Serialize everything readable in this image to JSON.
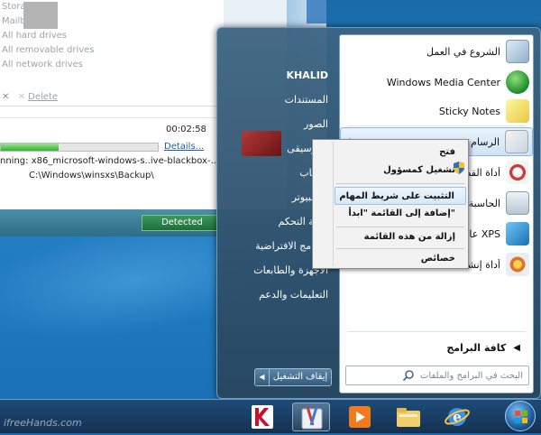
{
  "background_app": {
    "drives": [
      "All hard drives",
      "All removable drives",
      "All network drives"
    ],
    "drive_items": [
      "Storage",
      "Mailboxes",
      "All hard drives",
      "All removable drives",
      "All network drives"
    ],
    "delete_label": "Delete",
    "elapsed_time": "00:02:58",
    "progress_fraction": 0.37,
    "details_link": "Details...",
    "scanning_line": "nning:  x86_microsoft-windows-s..ive-blackbox-...",
    "scanning_path": "C:\\Windows\\winsxs\\Backup\\",
    "detected_button": "Detected"
  },
  "start_menu": {
    "programs": [
      {
        "label": "الشروع في العمل",
        "icon": "getting-started-icon",
        "arrow": false
      },
      {
        "label": "Windows Media Center",
        "icon": "media-center-icon",
        "arrow": false
      },
      {
        "label": "Sticky Notes",
        "icon": "sticky-notes-icon",
        "arrow": false
      },
      {
        "label": "الرسام",
        "icon": "paint-icon",
        "arrow": true,
        "selected": true
      },
      {
        "label": "أداة القطع",
        "icon": "snipping-tool-icon",
        "arrow": false
      },
      {
        "label": "الحاسبة",
        "icon": "calculator-icon",
        "arrow": false
      },
      {
        "label": "عارض XPS",
        "icon": "xps-viewer-icon",
        "arrow": false
      },
      {
        "label": "أداة إنشاء",
        "icon": "burn-tool-icon",
        "arrow": false
      }
    ],
    "all_programs": "كافة البرامج",
    "search_placeholder": "البحث في البرامج والملفات",
    "places": [
      "KHALID",
      "المستندات",
      "الصور",
      "الموسيقى",
      "الألعاب",
      "الكمبيوتر",
      "لوحة التحكم",
      "البرامج الافتراضية",
      "الأجهزة والطابعات",
      "التعليمات والدعم"
    ],
    "shutdown_label": "إيقاف التشغيل"
  },
  "context_menu": {
    "items": [
      {
        "label": "فتح"
      },
      {
        "label": "تشغيل كمسؤول"
      },
      {
        "label": "التثبيت على شريط المهام",
        "highlight": true
      },
      {
        "label": "إضافة إلى القائمة \"ابدأ\""
      },
      {
        "label": "إزالة من هذه القائمة"
      },
      {
        "label": "خصائص"
      }
    ]
  },
  "taskbar": {
    "watermark": "ifreeHands.com",
    "items": [
      "kaspersky-icon",
      "paint-icon",
      "media-player-icon",
      "explorer-icon",
      "ie-icon",
      "start-orb"
    ]
  },
  "colors": {
    "desktop": "#2583c6",
    "highlight": "#cfe4f7",
    "progress": "#2fb52c"
  }
}
